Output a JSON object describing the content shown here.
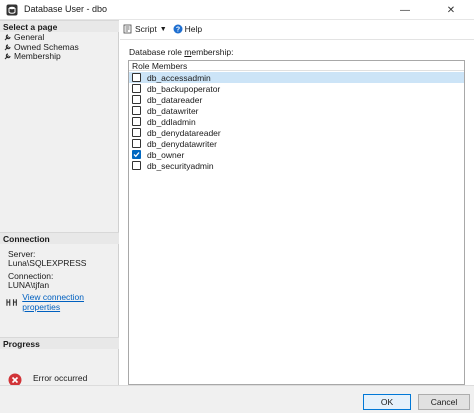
{
  "window": {
    "title": "Database User - dbo",
    "minimize_glyph": "—",
    "close_glyph": "✕"
  },
  "sidebar": {
    "select_page_header": "Select a page",
    "pages": [
      {
        "label": "General"
      },
      {
        "label": "Owned Schemas"
      },
      {
        "label": "Membership"
      }
    ],
    "connection_header": "Connection",
    "server_label": "Server:",
    "server_value": "Luna\\SQLEXPRESS",
    "connection_label": "Connection:",
    "connection_value": "LUNA\\tjfan",
    "view_link": "View connection properties",
    "progress_header": "Progress",
    "progress_status": "Error occurred"
  },
  "toolbar": {
    "script_label": "Script",
    "help_label": "Help"
  },
  "main": {
    "role_label_prefix": "Database role ",
    "role_label_underlined": "m",
    "role_label_suffix": "embership:",
    "column_header": "Role Members",
    "roles": [
      {
        "name": "db_accessadmin",
        "checked": false,
        "selected": true
      },
      {
        "name": "db_backupoperator",
        "checked": false,
        "selected": false
      },
      {
        "name": "db_datareader",
        "checked": false,
        "selected": false
      },
      {
        "name": "db_datawriter",
        "checked": false,
        "selected": false
      },
      {
        "name": "db_ddladmin",
        "checked": false,
        "selected": false
      },
      {
        "name": "db_denydatareader",
        "checked": false,
        "selected": false
      },
      {
        "name": "db_denydatawriter",
        "checked": false,
        "selected": false
      },
      {
        "name": "db_owner",
        "checked": true,
        "selected": false
      },
      {
        "name": "db_securityadmin",
        "checked": false,
        "selected": false
      }
    ]
  },
  "buttons": {
    "ok": "OK",
    "cancel": "Cancel"
  },
  "colors": {
    "accent": "#0067c0",
    "selection": "#cce4f7",
    "link": "#0060c0",
    "error": "#d13438"
  }
}
